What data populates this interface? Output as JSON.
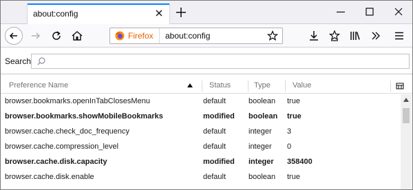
{
  "tab": {
    "title": "about:config"
  },
  "urlbar": {
    "identity_label": "Firefox",
    "url": "about:config"
  },
  "search": {
    "label": "Search:",
    "value": ""
  },
  "table": {
    "headers": {
      "name": "Preference Name",
      "status": "Status",
      "type": "Type",
      "value": "Value"
    },
    "rows": [
      {
        "name": "browser.bookmarks.openInTabClosesMenu",
        "status": "default",
        "type": "boolean",
        "value": "true",
        "modified": false
      },
      {
        "name": "browser.bookmarks.showMobileBookmarks",
        "status": "modified",
        "type": "boolean",
        "value": "true",
        "modified": true
      },
      {
        "name": "browser.cache.check_doc_frequency",
        "status": "default",
        "type": "integer",
        "value": "3",
        "modified": false
      },
      {
        "name": "browser.cache.compression_level",
        "status": "default",
        "type": "integer",
        "value": "0",
        "modified": false
      },
      {
        "name": "browser.cache.disk.capacity",
        "status": "modified",
        "type": "integer",
        "value": "358400",
        "modified": true
      },
      {
        "name": "browser.cache.disk.enable",
        "status": "default",
        "type": "boolean",
        "value": "true",
        "modified": false
      }
    ]
  },
  "colors": {
    "accent": "#0a84ff",
    "firefox_orange": "#e66000"
  }
}
